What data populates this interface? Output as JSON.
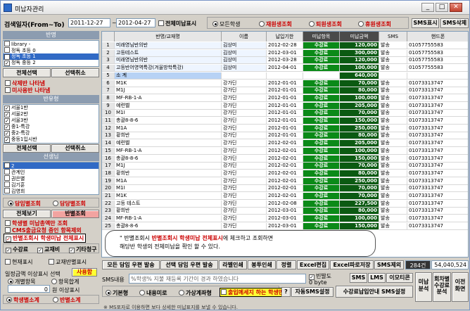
{
  "window": {
    "title": "미납자관리",
    "min": "_",
    "max": "□",
    "close": "✕"
  },
  "search": {
    "label": "검색일자(From~To)",
    "from": "2011-12-27",
    "to": "2012-04-27",
    "sep": "~",
    "all_unpaid": "전체미납표시"
  },
  "filters": {
    "options": [
      "모든학생",
      "재원생조회",
      "퇴원생조회",
      "휴원생조회"
    ],
    "selected": 0
  },
  "top_buttons": {
    "sms_show": "SMS표시",
    "sms_delete": "SMS삭제"
  },
  "class_panel": {
    "header": "반명",
    "items": [
      "library -",
      "정독 초등 0",
      "정독 초등 1",
      "정독 중등 2"
    ],
    "selected": 2,
    "select_all": "전체선택",
    "deselect": "선택취소",
    "deleted_class": "삭제반 나타냄",
    "unused_class": "미사용반 나타냄"
  },
  "section_panel": {
    "header": "반유형",
    "items": [
      "서울1반",
      "서울2반",
      "서울3반",
      "중1-특강",
      "중2-특강",
      "중등1입시반"
    ],
    "select_all": "전체선택",
    "deselect": "선택취소"
  },
  "teacher_panel": {
    "header": "선생님",
    "items": [
      "2",
      "관계인",
      "권은별",
      "김기훈",
      "김영희"
    ],
    "selected": 0
  },
  "left_options": {
    "by_class": "담임별조회",
    "by_student": "담당별조회",
    "view_all": "전체보기",
    "view_by_class": "반별조회",
    "line1": "학생별 미납총액만 조회",
    "line2": "CMS출금요청 중인 항목제외",
    "line3": "반별조회시 학생미납 전체표시",
    "tuition": "수강료",
    "textbook": "교재비",
    "other": "기타청구",
    "current_students": "현재표시",
    "textbook_students": "교재반별표시",
    "threshold_label": "일정금액 이상표시 선택",
    "use_btn": "사용함",
    "by_student_opt": "개별항목",
    "total_opt": "항목합계",
    "threshold_value": "0",
    "threshold_unit": "원 이상표시",
    "student_total": "학생별소계",
    "class_total": "반별소계"
  },
  "table": {
    "columns": [
      "",
      "반명/교재명",
      "이름",
      "납입기한",
      "미납항목",
      "미납금액",
      "SMS",
      "핸드폰"
    ],
    "rows": [
      [
        "1",
        "미래영님반의반",
        "김상미",
        "2012-02-28",
        "수강료",
        "120,000",
        "발송",
        "01057755583"
      ],
      [
        "2",
        "고등테스트",
        "김상미",
        "2012-03-01",
        "수강료",
        "300,000",
        "발송",
        "01057755583"
      ],
      [
        "3",
        "미래영님반의반",
        "김상미",
        "2012-03-28",
        "수강료",
        "120,000",
        "발송",
        "01057755583"
      ],
      [
        "4",
        "고등반어영역특강(겨울방학특강)",
        "김상미",
        "2012-04-01",
        "수강료",
        "100,000",
        "발송",
        "01057755583"
      ],
      [
        "5",
        "소 계",
        "",
        "",
        "",
        "640,000",
        "",
        ""
      ],
      [
        "6",
        "M1K",
        "강가딘",
        "2012-01-01",
        "수강료",
        "70,000",
        "발송",
        "01073313747"
      ],
      [
        "7",
        "M1J",
        "강가딘",
        "2012-01-01",
        "수강료",
        "80,000",
        "발송",
        "01073313747"
      ],
      [
        "8",
        "MF-RB-1-A",
        "강가딘",
        "2012-01-01",
        "수강료",
        "100,000",
        "발송",
        "01073313747"
      ],
      [
        "9",
        "예련벨",
        "강가딘",
        "2012-01-01",
        "수강료",
        "205,000",
        "발송",
        "01073313747"
      ],
      [
        "10",
        "M1I",
        "강가딘",
        "2012-01-01",
        "수강료",
        "70,000",
        "발송",
        "01073313747"
      ],
      [
        "11",
        "총괄8-8-6",
        "강가딘",
        "2012-01-01",
        "수강료",
        "150,000",
        "발송",
        "01073313747"
      ],
      [
        "12",
        "M1A",
        "강가딘",
        "2012-01-01",
        "수강료",
        "250,000",
        "발송",
        "01073313747"
      ],
      [
        "13",
        "황희반",
        "강가딘",
        "2012-01-01",
        "수강료",
        "80,000",
        "발송",
        "01073313747"
      ],
      [
        "14",
        "예련벨",
        "강가딘",
        "2012-02-01",
        "수강료",
        "205,000",
        "발송",
        "01073313747"
      ],
      [
        "15",
        "MF-RB-1-A",
        "강가딘",
        "2012-02-01",
        "수강료",
        "100,000",
        "발송",
        "01073313747"
      ],
      [
        "16",
        "총괄8-8-6",
        "강가딘",
        "2012-02-01",
        "수강료",
        "150,000",
        "발송",
        "01073313747"
      ],
      [
        "17",
        "M1J",
        "강가딘",
        "2012-02-01",
        "수강료",
        "70,000",
        "발송",
        "01073313747"
      ],
      [
        "18",
        "황희반",
        "강가딘",
        "2012-02-01",
        "수강료",
        "80,000",
        "발송",
        "01073313747"
      ],
      [
        "19",
        "M1A",
        "강가딘",
        "2012-02-01",
        "수강료",
        "250,000",
        "발송",
        "01073313747"
      ],
      [
        "20",
        "M1I",
        "강가딘",
        "2012-02-01",
        "수강료",
        "70,000",
        "발송",
        "01073313747"
      ],
      [
        "21",
        "M1K",
        "강가딘",
        "2012-02-01",
        "수강료",
        "70,000",
        "발송",
        "01073313747"
      ],
      [
        "22",
        "고등 테스트",
        "강가딘",
        "2012-02-08",
        "수강료",
        "227,500",
        "발송",
        "01073313747"
      ],
      [
        "23",
        "황희반",
        "강가딘",
        "2012-03-01",
        "수강료",
        "80,000",
        "발송",
        "01073313747"
      ],
      [
        "24",
        "MF-RB-1-A",
        "강가딘",
        "2012-03-01",
        "수강료",
        "100,000",
        "발송",
        "01073313747"
      ],
      [
        "25",
        "총괄8-8-6",
        "강가딘",
        "2012-03-01",
        "수강료",
        "150,000",
        "발송",
        "01073313747"
      ]
    ]
  },
  "tooltip": {
    "l1_a": "\" 반별조회시 ",
    "l1_b": "반별조회시 학생미납 전체표시",
    "l1_c": "에 체크하고 조회하면",
    "l2": "해당반 학생의 전체미납을 확인 할 수 있다."
  },
  "bottom_bar": {
    "buttons": [
      "모든 담임 우편 발송",
      "선택 담임 우편 발송",
      "라벨인쇄",
      "봉투인쇄",
      "정렬",
      "Excel편집",
      "Excel파로저장",
      "SMS제외"
    ],
    "count": "284건",
    "total": "54,040,524"
  },
  "sms": {
    "label": "SMS내용",
    "content": "%학생% 지불 재등록 기간이 경과 하였습니다",
    "bytes": "0 byte",
    "sms_btn": "SMS",
    "lms_btn": "LMS",
    "emoticon_btn": "이모티콘",
    "return_chk": "빈발도",
    "modes": [
      "기본형",
      "내용미로",
      "가상계좌형",
      "출입메세지 하는 학생만"
    ],
    "help": "?",
    "auto_sms": "자동SMS설정",
    "tuition_sms": "수강료납입안내 SMS설정",
    "unpaid_btn": "미납분석",
    "student_btn": "회차별수강료분석",
    "exit_btn": "이전화면",
    "notice": "※ MS포자로 이용하면 보다 상세한 미납표지를 보낼 수 있습니다."
  }
}
